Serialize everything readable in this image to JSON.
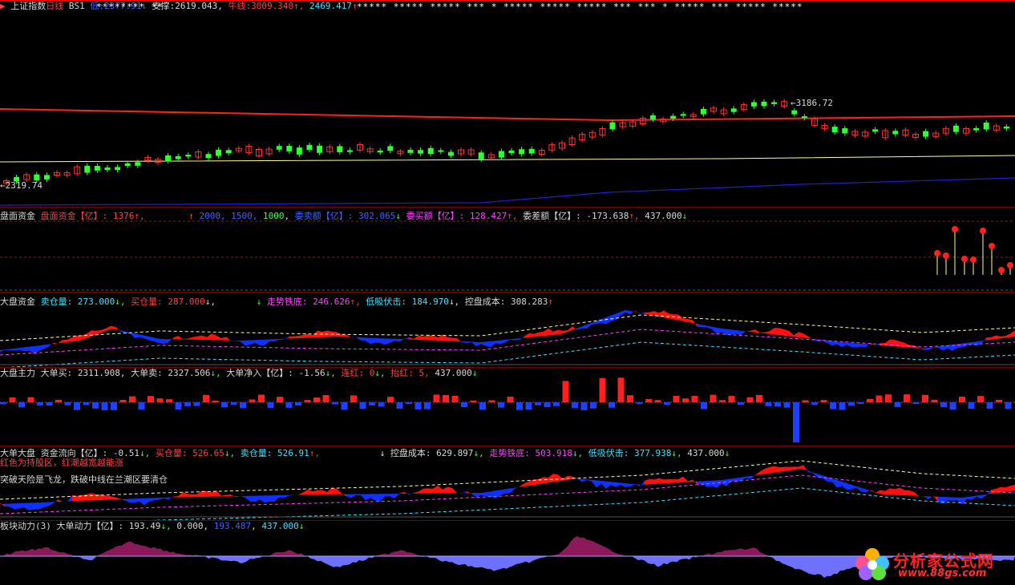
{
  "main": {
    "title": "上证指数",
    "period": "日线",
    "bs": "BS1",
    "low_label": "低:",
    "low_value": "2377.91",
    "support_label": "支撑:",
    "support_value": "2619.043",
    "bull_label": "牛线:",
    "bull_value": "3009.340",
    "extra_value": "2469.417",
    "high_marker": "3186.72",
    "low_marker": "2319.74"
  },
  "pan": {
    "name": "盘面资金",
    "t1": "盘面资金【亿】: 1376",
    "t2": "2000",
    "t3": "1500",
    "t4": "1000",
    "t5": "委卖额【亿】: 302.065",
    "t6": "委买额【亿】: 128.427",
    "t7": "委差额【亿】: -173.638",
    "t8": "437.000"
  },
  "dapan": {
    "name": "大盘资金",
    "t1": "卖仓量: 273.000",
    "t2": "买仓量: 287.000",
    "t3": "走势铁底: 246.626",
    "t4": "低吸伏击: 184.970",
    "t5": "控盘成本: 308.283"
  },
  "zhuli": {
    "name": "大盘主力",
    "t1": "大单买: 2311.908",
    "t2": "大单卖: 2327.506",
    "t3": "大单净入【亿】: -1.56",
    "t4": "连红: 0",
    "t5": "抬红: 5",
    "t6": "437.000"
  },
  "dadan": {
    "name": "大单大盘",
    "t1": "资金流向【亿】: -0.51",
    "t2": "买仓量: 526.65",
    "t3": "卖仓量: 526.91",
    "t4": "控盘成本: 629.897",
    "t5": "走势铁底: 503.918",
    "t6": "低吸伏击: 377.938",
    "t7": "437.000",
    "note1": "红色为持股区，红潮越宽越能涨",
    "note2": "突破天险是飞龙，跌破中线在兰潮区要清仓"
  },
  "bankuai": {
    "name": "板块动力(3)",
    "t1": "大单动力【亿】: 193.49",
    "t2": "0.000",
    "t3": "193.487",
    "t4": "437.000"
  },
  "logo": {
    "text": "分析家公式网",
    "url": "www.88gs.com"
  },
  "colors": {
    "up": "#ff3030",
    "down": "#30ff30",
    "bull_line": "#ff2020",
    "support_line": "#ffff99",
    "slow_line": "#2020d0"
  }
}
